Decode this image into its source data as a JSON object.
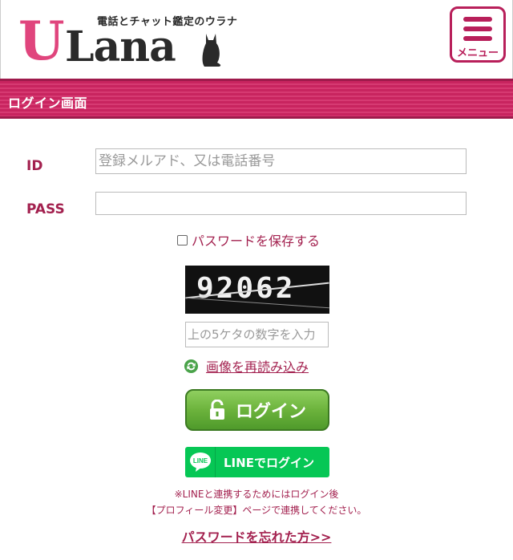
{
  "header": {
    "logo_letter": "U",
    "logo_word": "Lana",
    "tagline": "電話とチャット鑑定のウラナ",
    "menu_label": "メニュー"
  },
  "page_title": "ログイン画面",
  "form": {
    "id_label": "ID",
    "id_placeholder": "登録メルアド、又は電話番号",
    "id_value": "",
    "pass_label": "PASS",
    "pass_value": "",
    "save_password_label": "パスワードを保存する",
    "save_password_checked": false,
    "captcha_code": "92062",
    "captcha_placeholder": "上の5ケタの数字を入力",
    "reload_label": "画像を再読み込み",
    "login_button": "ログイン",
    "line_button": "LINEでログイン",
    "line_icon_text": "LINE",
    "note_line1": "※LINEと連携するためにはログイン後",
    "note_line2": "【プロフィール変更】ページで連携してください。",
    "forgot_link": "パスワードを忘れた方>>"
  },
  "colors": {
    "brand": "#a3214f",
    "accent_pink": "#e0457d",
    "login_green": "#6cb33c",
    "line_green": "#06c755"
  }
}
